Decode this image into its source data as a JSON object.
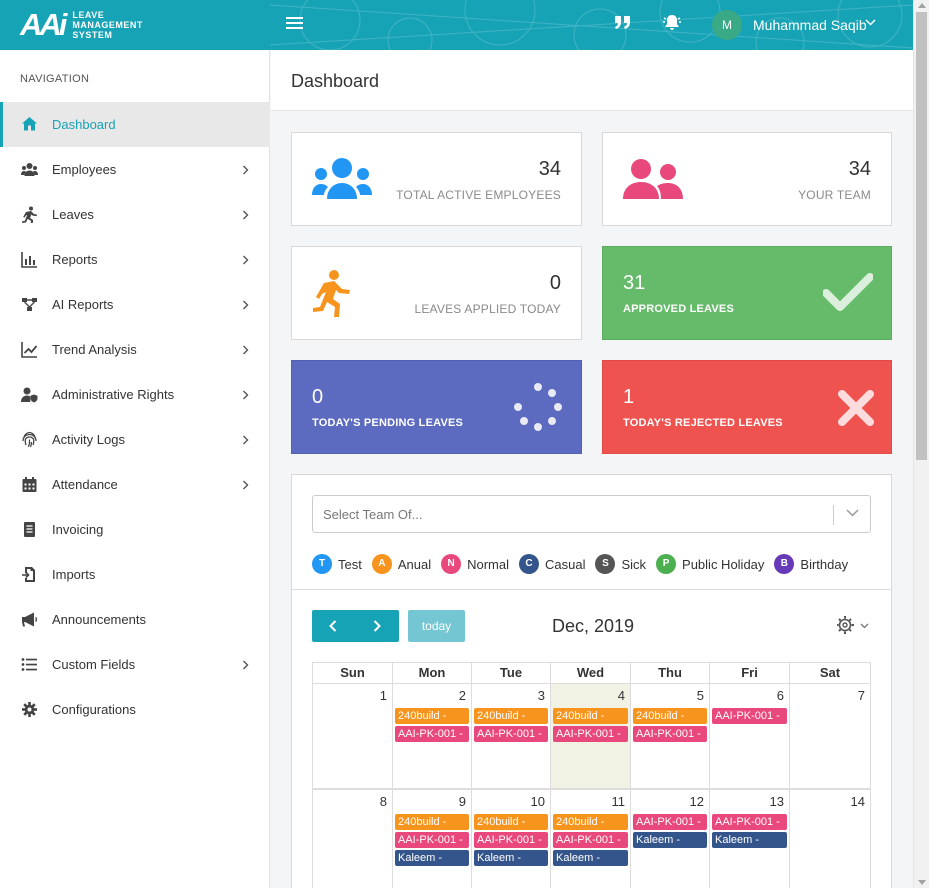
{
  "app": {
    "logo_mark": "AAi",
    "logo_line1": "LEAVE",
    "logo_line2": "MANAGEMENT",
    "logo_line3": "SYSTEM",
    "user_initial": "M",
    "user_name": "Muhammad Saqib"
  },
  "colors": {
    "brand": "#17a3b6",
    "blue": "#2196f3",
    "pink": "#e8487b",
    "orange": "#f7941d",
    "green": "#66bb6a",
    "indigo": "#5c6bc0",
    "red": "#ef5350"
  },
  "sidebar": {
    "heading": "NAVIGATION",
    "items": [
      {
        "label": "Dashboard",
        "icon": "home-icon",
        "has_children": false,
        "active": true
      },
      {
        "label": "Employees",
        "icon": "users-icon",
        "has_children": true
      },
      {
        "label": "Leaves",
        "icon": "running-icon",
        "has_children": true
      },
      {
        "label": "Reports",
        "icon": "bar-chart-icon",
        "has_children": true
      },
      {
        "label": "AI Reports",
        "icon": "network-icon",
        "has_children": true
      },
      {
        "label": "Trend Analysis",
        "icon": "line-chart-icon",
        "has_children": true
      },
      {
        "label": "Administrative Rights",
        "icon": "user-shield-icon",
        "has_children": true
      },
      {
        "label": "Activity Logs",
        "icon": "fingerprint-icon",
        "has_children": true
      },
      {
        "label": "Attendance",
        "icon": "calendar-icon",
        "has_children": true
      },
      {
        "label": "Invoicing",
        "icon": "invoice-icon",
        "has_children": false
      },
      {
        "label": "Imports",
        "icon": "import-icon",
        "has_children": false
      },
      {
        "label": "Announcements",
        "icon": "megaphone-icon",
        "has_children": false
      },
      {
        "label": "Custom Fields",
        "icon": "list-icon",
        "has_children": true
      },
      {
        "label": "Configurations",
        "icon": "gear-icon",
        "has_children": false
      }
    ]
  },
  "main": {
    "title": "Dashboard",
    "stats": {
      "total_active": {
        "value": "34",
        "label": "TOTAL ACTIVE EMPLOYEES"
      },
      "your_team": {
        "value": "34",
        "label": "YOUR TEAM"
      },
      "applied_today": {
        "value": "0",
        "label": "LEAVES APPLIED TODAY"
      },
      "approved": {
        "value": "31",
        "label": "APPROVED LEAVES"
      },
      "pending": {
        "value": "0",
        "label": "TODAY'S PENDING LEAVES"
      },
      "rejected": {
        "value": "1",
        "label": "TODAY'S REJECTED LEAVES"
      }
    }
  },
  "calendar": {
    "team_select_placeholder": "Select Team Of...",
    "legend": [
      {
        "letter": "T",
        "label": "Test",
        "color": "#2196f3"
      },
      {
        "letter": "A",
        "label": "Anual",
        "color": "#f7941d"
      },
      {
        "letter": "N",
        "label": "Normal",
        "color": "#e8487b"
      },
      {
        "letter": "C",
        "label": "Casual",
        "color": "#34558b"
      },
      {
        "letter": "S",
        "label": "Sick",
        "color": "#555555"
      },
      {
        "letter": "P",
        "label": "Public Holiday",
        "color": "#4caf50"
      },
      {
        "letter": "B",
        "label": "Birthday",
        "color": "#673ab7"
      }
    ],
    "today_label": "today",
    "month_title": "Dec, 2019",
    "days_of_week": [
      "Sun",
      "Mon",
      "Tue",
      "Wed",
      "Thu",
      "Fri",
      "Sat"
    ],
    "today_date": 4,
    "weeks": [
      {
        "days": [
          1,
          2,
          3,
          4,
          5,
          6,
          7
        ],
        "events": [
          [],
          [
            {
              "text": "240build -",
              "color": "#f7941d"
            },
            {
              "text": "AAI-PK-001 -",
              "color": "#e8487b"
            }
          ],
          [
            {
              "text": "240build -",
              "color": "#f7941d"
            },
            {
              "text": "AAI-PK-001 -",
              "color": "#e8487b"
            }
          ],
          [
            {
              "text": "240build -",
              "color": "#f7941d"
            },
            {
              "text": "AAI-PK-001 -",
              "color": "#e8487b"
            }
          ],
          [
            {
              "text": "240build -",
              "color": "#f7941d"
            },
            {
              "text": "AAI-PK-001 -",
              "color": "#e8487b"
            }
          ],
          [
            {
              "text": "AAI-PK-001 -",
              "color": "#e8487b"
            }
          ],
          []
        ]
      },
      {
        "days": [
          8,
          9,
          10,
          11,
          12,
          13,
          14
        ],
        "events": [
          [],
          [
            {
              "text": "240build -",
              "color": "#f7941d"
            },
            {
              "text": "AAI-PK-001 -",
              "color": "#e8487b"
            },
            {
              "text": "Kaleem -",
              "color": "#34558b"
            }
          ],
          [
            {
              "text": "240build -",
              "color": "#f7941d"
            },
            {
              "text": "AAI-PK-001 -",
              "color": "#e8487b"
            },
            {
              "text": "Kaleem -",
              "color": "#34558b"
            }
          ],
          [
            {
              "text": "240build -",
              "color": "#f7941d"
            },
            {
              "text": "AAI-PK-001 -",
              "color": "#e8487b"
            },
            {
              "text": "Kaleem -",
              "color": "#34558b"
            }
          ],
          [
            {
              "text": "AAI-PK-001 -",
              "color": "#e8487b"
            },
            {
              "text": "Kaleem -",
              "color": "#34558b"
            }
          ],
          [
            {
              "text": "AAI-PK-001 -",
              "color": "#e8487b"
            },
            {
              "text": "Kaleem -",
              "color": "#34558b"
            }
          ],
          []
        ]
      }
    ]
  }
}
